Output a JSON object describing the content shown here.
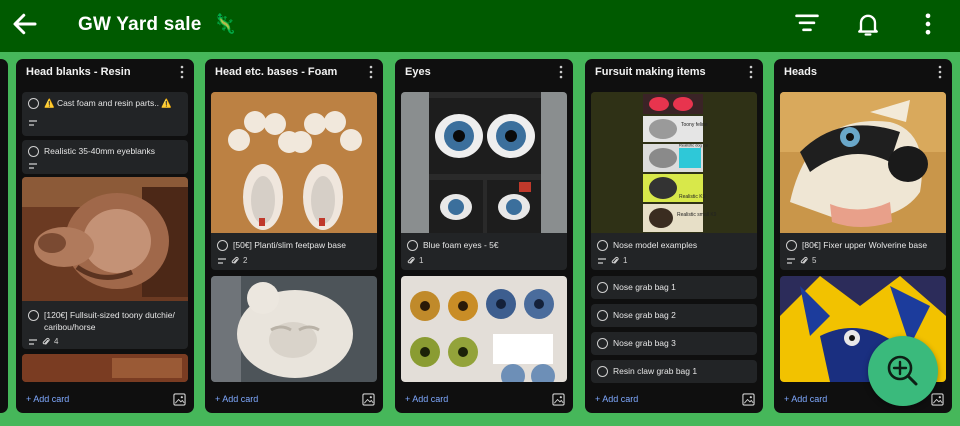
{
  "header": {
    "title": "GW Yard sale",
    "title_emoji": "🦎"
  },
  "columns": [
    {
      "title": "Head blanks - Resin",
      "add_card": "+ Add card",
      "cards": [
        {
          "title": "⚠️ Cast foam and resin parts.. ⚠️",
          "has_description": true
        },
        {
          "title": "Realistic 35-40mm eyeblanks",
          "has_description": true
        },
        {
          "title": "[120€] Fullsuit-sized toony dutchie/ caribou/horse",
          "has_description": true,
          "attachments": "4",
          "cover": "resin-head"
        }
      ]
    },
    {
      "title": "Head etc. bases - Foam",
      "add_card": "+ Add card",
      "cards": [
        {
          "title": "[50€] Planti/slim feetpaw base",
          "has_description": true,
          "attachments": "2",
          "cover": "feetpaws"
        },
        {
          "title": "",
          "cover": "foam-head"
        }
      ]
    },
    {
      "title": "Eyes",
      "add_card": "+ Add card",
      "cards": [
        {
          "title": "Blue foam eyes - 5€",
          "attachments": "1",
          "cover": "foam-eyes"
        },
        {
          "title": "",
          "cover": "resin-eyes"
        }
      ]
    },
    {
      "title": "Fursuit making items",
      "add_card": "+ Add card",
      "cards": [
        {
          "title": "Nose model examples",
          "has_description": true,
          "attachments": "1",
          "cover": "noses"
        },
        {
          "title": "Nose grab bag 1"
        },
        {
          "title": "Nose grab bag 2"
        },
        {
          "title": "Nose grab bag 3"
        },
        {
          "title": "Resin claw grab bag 1"
        }
      ],
      "cover_labels": [
        "Toony feline",
        "Realistic dog cat",
        "Realistic K9",
        "Realistic small K9"
      ]
    },
    {
      "title": "Heads",
      "add_card": "+ Add card",
      "cards": [
        {
          "title": "[80€] Fixer upper Wolverine base",
          "has_description": true,
          "attachments": "5",
          "cover": "wolverine"
        },
        {
          "title": "",
          "cover": "blue-yellow-head"
        }
      ]
    }
  ],
  "icons": {
    "back": "arrow-left-icon",
    "filter": "filter-icon",
    "notifications": "bell-icon",
    "menu": "more-vertical-icon",
    "fab": "zoom-in-icon"
  },
  "colors": {
    "header_bg": "#005a00",
    "board_bg": "#46b75a",
    "column_bg": "#0f0f0f",
    "card_bg": "#222426",
    "add_card_link": "#7fa9ff",
    "fab": "#3aba7c"
  }
}
